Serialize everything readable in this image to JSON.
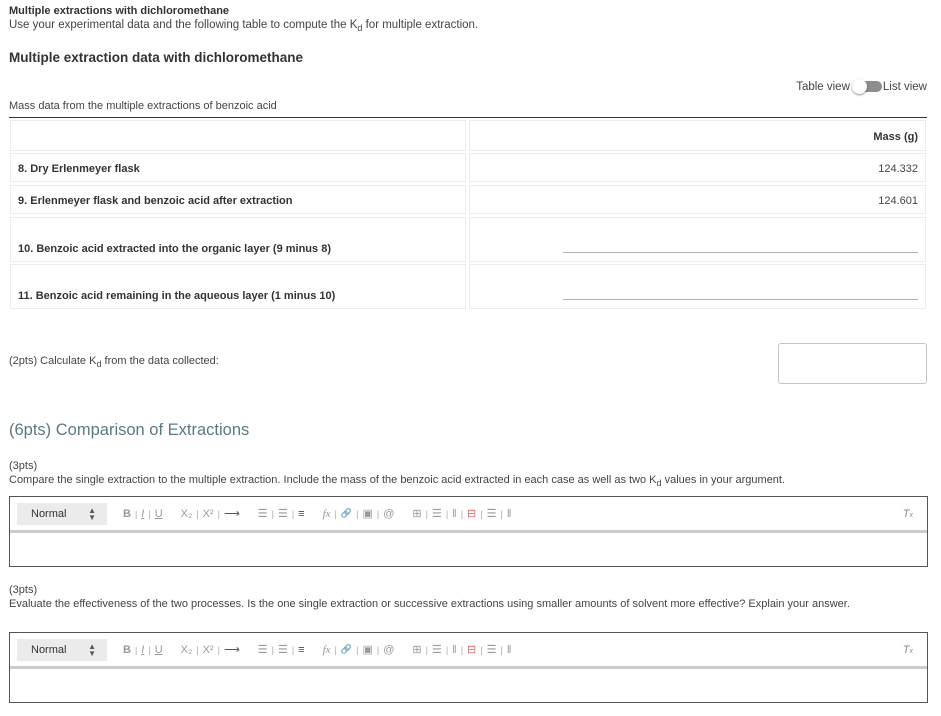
{
  "header": {
    "title": "Multiple extractions with dichloromethane",
    "intro_before": "Use your experimental data and the following table to compute the K",
    "intro_sub": "d",
    "intro_after": " for multiple extraction."
  },
  "table_section": {
    "heading": "Multiple extraction data with dichloromethane",
    "caption": "Mass data from the multiple extractions of benzoic acid",
    "view_toggle": {
      "left_label": "Table view",
      "right_label": "List view",
      "selected": "Table view"
    },
    "column_header": "Mass (g)",
    "rows": [
      {
        "label": "8. Dry Erlenmeyer flask",
        "value": "124.332"
      },
      {
        "label": "9. Erlenmeyer flask and benzoic acid after extraction",
        "value": "124.601"
      },
      {
        "label": "10. Benzoic acid extracted into the organic layer (9 minus 8)",
        "value": ""
      },
      {
        "label": "11. Benzoic acid remaining in the aqueous layer (1 minus 10)",
        "value": ""
      }
    ]
  },
  "kd_question": {
    "before": "(2pts)  Calculate K",
    "sub": "d",
    "after": " from the data collected:",
    "answer": ""
  },
  "comparison": {
    "title": "(6pts) Comparison of Extractions",
    "questions": [
      {
        "points": "(3pts)",
        "text_before": "Compare the single extraction to the multiple extraction. Include the mass of the benzoic acid extracted in each case as well as two K",
        "text_sub": "d",
        "text_after": " values in your argument.",
        "answer": ""
      },
      {
        "points": "(3pts)",
        "text_before": "Evaluate the effectiveness of the two processes. Is the one single extraction or successive extractions using smaller amounts of solvent more effective? Explain your answer.",
        "text_sub": "",
        "text_after": "",
        "answer": ""
      }
    ]
  },
  "editor_toolbar": {
    "format_value": "Normal",
    "format_arrows": "▲▼",
    "bold": "B",
    "italic": "I",
    "underline": "U",
    "subscript": "X₂",
    "superscript": "X²",
    "indent": "⟶",
    "ordered_list": "☰",
    "bullet_list": "☰",
    "align": "≡",
    "formula": "fx",
    "link": "🔗",
    "image": "▣",
    "attach": "@",
    "insert_table": "⊞",
    "insert_row": "☰",
    "insert_column": "‖",
    "delete_table": "⊟",
    "delete_row": "☰",
    "delete_column": "‖",
    "clear_format": "T",
    "clear_format_sub": "x"
  }
}
